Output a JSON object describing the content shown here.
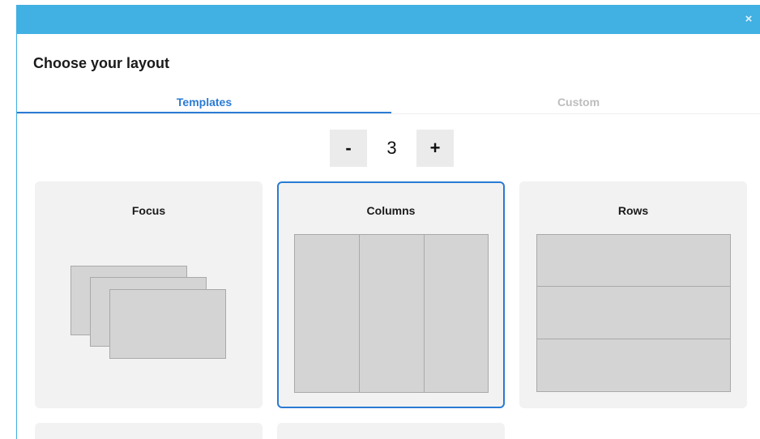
{
  "dialog": {
    "close_icon": "close-icon",
    "close_glyph": "×",
    "heading": "Choose your layout"
  },
  "tabs": [
    {
      "label": "Templates",
      "active": true
    },
    {
      "label": "Custom",
      "active": false
    }
  ],
  "stepper": {
    "minus_label": "-",
    "value": "3",
    "plus_label": "+"
  },
  "layouts": [
    {
      "title": "Focus",
      "selected": false
    },
    {
      "title": "Columns",
      "selected": true
    },
    {
      "title": "Rows",
      "selected": false
    },
    {
      "title": "",
      "selected": false
    },
    {
      "title": "",
      "selected": false
    }
  ],
  "colors": {
    "titlebar": "#41b0e3",
    "accent": "#2a7bd4",
    "card_bg": "#f2f2f2",
    "pane_fill": "#d4d4d4",
    "pane_border": "#a9a9a9"
  }
}
